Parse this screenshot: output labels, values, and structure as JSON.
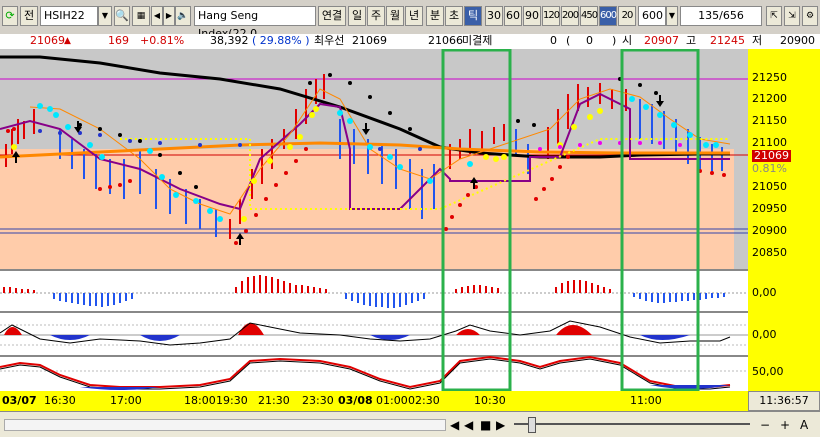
{
  "toolbar": {
    "refresh_icon": "refresh-icon",
    "mode": "전",
    "symbol": "HSIH22",
    "name": "Hang Seng Index(22.0",
    "continuous": "연결",
    "periods": [
      "일",
      "주",
      "월",
      "년",
      "분",
      "초",
      "틱"
    ],
    "intervals": [
      "30",
      "60",
      "90",
      "120",
      "200",
      "450",
      "600",
      "20"
    ],
    "interval_select": "600",
    "count": "135/656"
  },
  "info": {
    "price": "21069",
    "change": "169",
    "change_pct": "+0.81%",
    "volume": "38,392",
    "vol_ratio": "( 29.88% )",
    "best_label": "최우선",
    "best_price": "21069",
    "unfilled_price": "21066",
    "unfilled_label": "미결제",
    "unfilled_qty": "0",
    "unfilled_paren_open": "(",
    "unfilled_change": "0",
    "unfilled_paren_close": ")",
    "open_label": "시",
    "open_price": "20907",
    "high_label": "고",
    "high_price": "21245",
    "low_label": "저",
    "low_price": "20900"
  },
  "yaxis": {
    "price": [
      "21250",
      "21200",
      "21150",
      "21100",
      "21050",
      "21000",
      "20950",
      "20900",
      "20850"
    ],
    "current": "21069",
    "current_pct": "0.81%",
    "osc1": "0,00",
    "osc2": "0,00",
    "osc3": "50,00"
  },
  "xaxis": {
    "labels": [
      "03/07",
      "16:30",
      "17:00",
      "18:00",
      "19:30",
      "21:30",
      "23:30",
      "03/08",
      "01:00",
      "02:30",
      "10:30",
      "11:00"
    ],
    "time": "11:36:57"
  },
  "bottom": {
    "prev": "◀",
    "stop": "■",
    "play": "▶",
    "minus": "−",
    "plus": "+",
    "font": "A"
  },
  "colors": {
    "up": "#e00000",
    "down": "#2255ee",
    "ma_black": "#000000",
    "ma_orange": "#ff8800",
    "highlight": "#2bb14b"
  }
}
